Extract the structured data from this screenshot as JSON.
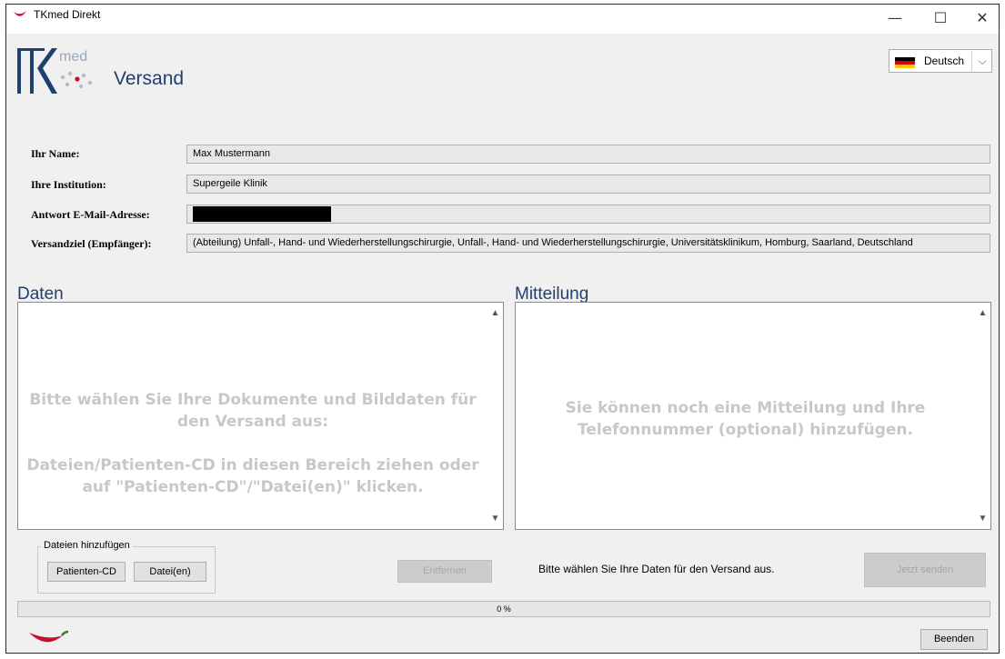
{
  "window": {
    "title": "TKmed Direkt",
    "minimize": "—",
    "maximize": "☐",
    "close": "✕"
  },
  "header": {
    "logo_text": "med",
    "app_title": "Versand",
    "language": {
      "selected": "Deutsch",
      "flag_colors": [
        "#000000",
        "#dd0000",
        "#ffce00"
      ]
    }
  },
  "form": {
    "name": {
      "label": "Ihr Name:",
      "value": "Max Mustermann"
    },
    "institution": {
      "label": "Ihre Institution:",
      "value": "Supergeile Klinik"
    },
    "email": {
      "label": "Antwort E-Mail-Adresse:",
      "value": ""
    },
    "target": {
      "label": "Versandziel (Empfänger):",
      "value": "(Abteilung) Unfall-, Hand- und Wiederherstellungschirurgie, Unfall-, Hand- und Wiederherstellungschirurgie, Universitätsklinikum, Homburg, Saarland, Deutschland"
    }
  },
  "data_section": {
    "title": "Daten",
    "hint_line1": "Bitte wählen Sie Ihre Dokumente und Bilddaten für",
    "hint_line2": "den Versand aus:",
    "hint_line3": "Dateien/Patienten-CD in diesen Bereich ziehen oder",
    "hint_line4": "auf \"Patienten-CD\"/\"Datei(en)\" klicken."
  },
  "message_section": {
    "title": "Mitteilung",
    "hint_line1": "Sie können noch eine Mitteilung und Ihre",
    "hint_line2": "Telefonnummer (optional) hinzufügen."
  },
  "add_files": {
    "group_title": "Dateien hinzufügen",
    "patient_cd": "Patienten-CD",
    "files": "Datei(en)"
  },
  "remove_button": "Entfernen",
  "status_text": "Bitte wählen Sie Ihre Daten für den Versand aus.",
  "send_button": "Jetzt senden",
  "progress": {
    "percent": 0,
    "text": "0 %"
  },
  "exit_button": "Beenden",
  "colors": {
    "accent": "#1f3f6e",
    "logo_red": "#c8102e"
  }
}
